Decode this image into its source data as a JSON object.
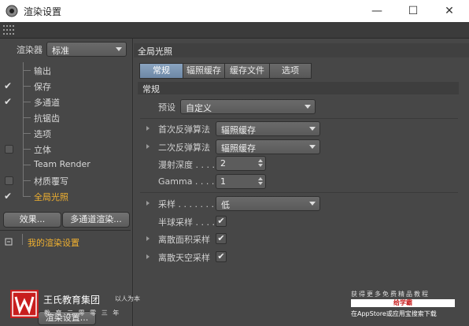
{
  "window": {
    "title": "渲染设置",
    "minimize": "—",
    "maximize": "☐",
    "close": "✕"
  },
  "left_panel": {
    "renderer_label": "渲染器",
    "renderer_value": "标准",
    "tree": [
      {
        "label": "输出",
        "check": "",
        "box": false,
        "active": false
      },
      {
        "label": "保存",
        "check": "✔",
        "box": false,
        "active": false
      },
      {
        "label": "多通道",
        "check": "✔",
        "box": false,
        "active": false
      },
      {
        "label": "抗锯齿",
        "check": "",
        "box": false,
        "active": false
      },
      {
        "label": "选项",
        "check": "",
        "box": false,
        "active": false
      },
      {
        "label": "立体",
        "check": "",
        "box": true,
        "active": false
      },
      {
        "label": "Team Render",
        "check": "",
        "box": false,
        "active": false
      },
      {
        "label": "材质覆写",
        "check": "",
        "box": true,
        "active": false
      },
      {
        "label": "全局光照",
        "check": "✔",
        "box": false,
        "active": true
      }
    ],
    "effects_button": "效果...",
    "multipass_button": "多通道渲染...",
    "setting_name": "我的渲染设置",
    "bottom_button": "渲染设置..."
  },
  "right_panel": {
    "header": "全局光照",
    "tabs": [
      "常规",
      "辐照缓存",
      "缓存文件",
      "选项"
    ],
    "selected_tab": 0,
    "section_title": "常规",
    "preset_label": "预设",
    "preset_value": "自定义",
    "primary_label": "首次反弹算法",
    "primary_value": "辐照缓存",
    "secondary_label": "二次反弹算法",
    "secondary_value": "辐照缓存",
    "diffuse_depth_label": "漫射深度 . . . .",
    "diffuse_depth_value": "2",
    "gamma_label": "Gamma . . . .",
    "gamma_value": "1",
    "sampling_label": "采样 . . . . . . .",
    "sampling_value": "低",
    "hemi_label": "半球采样 . . . .",
    "hemi_checked": "✔",
    "discrete_area_label": "离散面积采样",
    "discrete_area_checked": "✔",
    "discrete_sky_label": "离散天空采样",
    "discrete_sky_checked": "✔"
  },
  "watermark": {
    "brand_name": "王氏教育集团",
    "slogan": "以人为本",
    "brand_sub": "教 育 二 零 零 三 年",
    "top_text": "获得更多免费精品教程",
    "mid_text": "给学霸",
    "bot_text": "在AppStore或应用宝搜索下载",
    "logo_color": "#c81e1e"
  }
}
